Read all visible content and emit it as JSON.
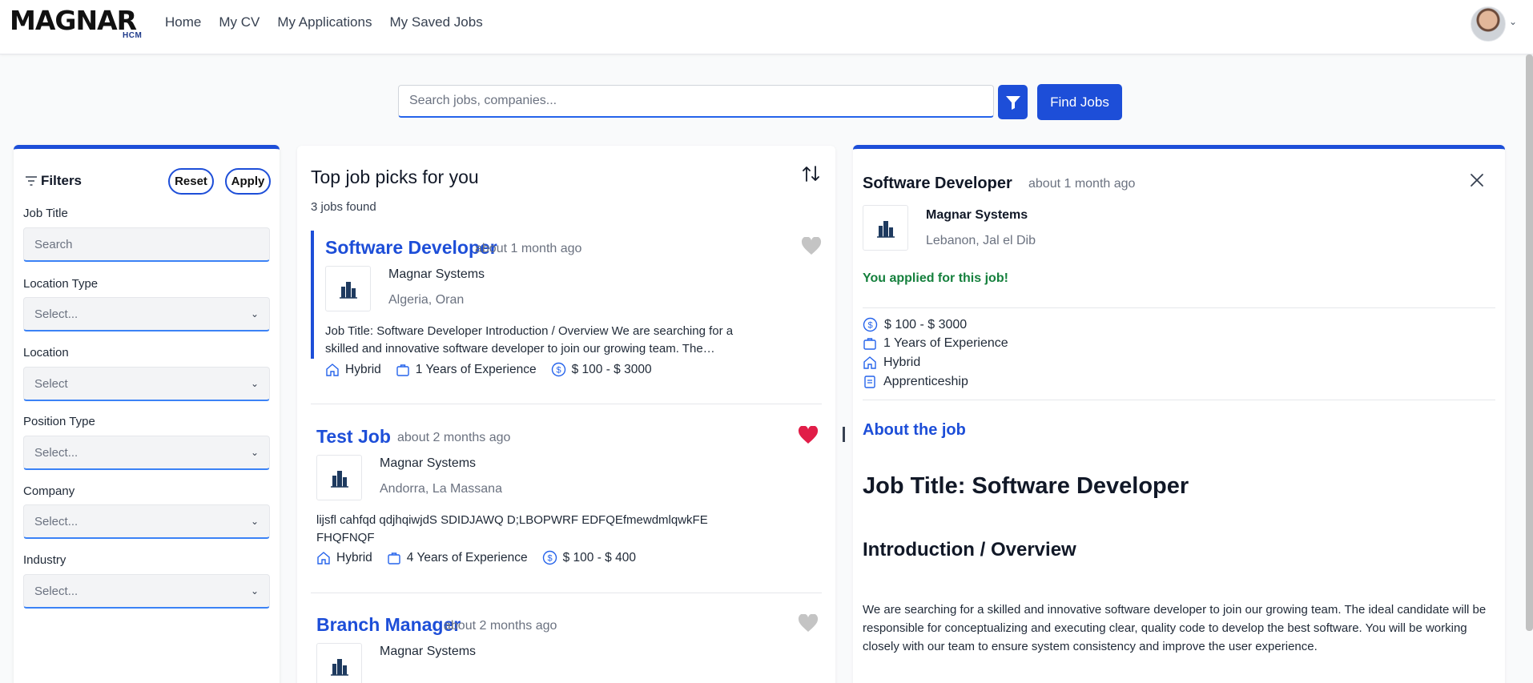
{
  "brand": {
    "logo_text": "MAGNAR",
    "logo_sub": "HCM"
  },
  "nav": {
    "items": [
      "Home",
      "My CV",
      "My Applications",
      "My Saved Jobs"
    ]
  },
  "search": {
    "placeholder": "Search jobs, companies...",
    "find_label": "Find Jobs"
  },
  "filters": {
    "title": "Filters",
    "reset_label": "Reset",
    "apply_label": "Apply",
    "fields": [
      {
        "label": "Job Title",
        "value": "Search",
        "kind": "input"
      },
      {
        "label": "Location Type",
        "value": "Select...",
        "kind": "select"
      },
      {
        "label": "Location",
        "value": "Select",
        "kind": "select"
      },
      {
        "label": "Position Type",
        "value": "Select...",
        "kind": "select"
      },
      {
        "label": "Company",
        "value": "Select...",
        "kind": "select"
      },
      {
        "label": "Industry",
        "value": "Select...",
        "kind": "select"
      }
    ]
  },
  "joblist": {
    "title": "Top job picks for you",
    "count": "3 jobs found",
    "jobs": [
      {
        "title": "Software Developer",
        "age": "about 1 month ago",
        "company": "Magnar Systems",
        "location": "Algeria, Oran",
        "description": "Job Title: Software Developer Introduction / Overview We are searching for a skilled and innovative software developer to join our growing team. The…",
        "location_type": "Hybrid",
        "experience": "1 Years of Experience",
        "salary": "$ 100 - $ 3000",
        "saved": false
      },
      {
        "title": "Test Job",
        "age": "about 2 months ago",
        "company": "Magnar Systems",
        "location": "Andorra, La Massana",
        "description": "lijsfl cahfqd qdjhqiwjdS SDIDJAWQ D;LBOPWRF EDFQEfmewdmlqwkFE FHQFNQF",
        "location_type": "Hybrid",
        "experience": "4 Years of Experience",
        "salary": "$ 100 - $ 400",
        "saved": true
      },
      {
        "title": "Branch Manager",
        "age": "about 2 months ago",
        "company": "Magnar Systems",
        "saved": false
      }
    ]
  },
  "detail": {
    "title": "Software Developer",
    "age": "about 1 month ago",
    "company": "Magnar Systems",
    "location": "Lebanon, Jal el Dib",
    "applied": "You applied for this job!",
    "salary": "$ 100 - $ 3000",
    "experience": "1 Years of Experience",
    "location_type": "Hybrid",
    "position_type": "Apprenticeship",
    "about_heading": "About the job",
    "h1": "Job Title: Software Developer",
    "h2": "Introduction / Overview",
    "paragraph": "We are searching for a skilled and innovative software developer to join our growing team. The ideal candidate will be responsible for conceptualizing and executing clear, quality code to develop the best software. You will be working closely with our team to ensure system consistency and improve the user experience."
  },
  "colors": {
    "accent": "#1d4ed8",
    "applied": "#15803d",
    "heart_saved": "#e11d48",
    "heart_unsaved": "#c4c4c4"
  }
}
